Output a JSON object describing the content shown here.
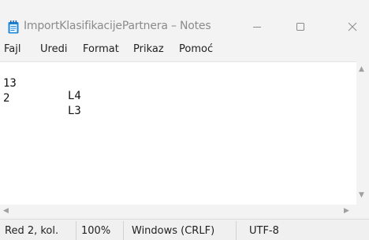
{
  "window": {
    "title": "ImportKlasifikacijePartnera – Notes",
    "minimize_glyph": "—",
    "maximize_glyph": "☐",
    "close_glyph": "✕"
  },
  "menu": [
    "Fajl",
    "Uredi",
    "Format",
    "Prikaz",
    "Pomoć"
  ],
  "editor": {
    "lines": [
      {
        "col1": "13",
        "col2": "L4"
      },
      {
        "col1": "2",
        "col2": "L3"
      }
    ]
  },
  "scrollbars": {
    "up_arrow": "▲",
    "down_arrow": "▼",
    "left_arrow": "◀",
    "right_arrow": "▶"
  },
  "status": {
    "position": "Red 2, kol.",
    "zoom": "100%",
    "line_ending": "Windows (CRLF)",
    "encoding": "UTF-8"
  },
  "icons": {
    "app": "notepad-icon"
  },
  "colors": {
    "chrome": "#f3f3f3",
    "icon_blue": "#1e88d8"
  }
}
